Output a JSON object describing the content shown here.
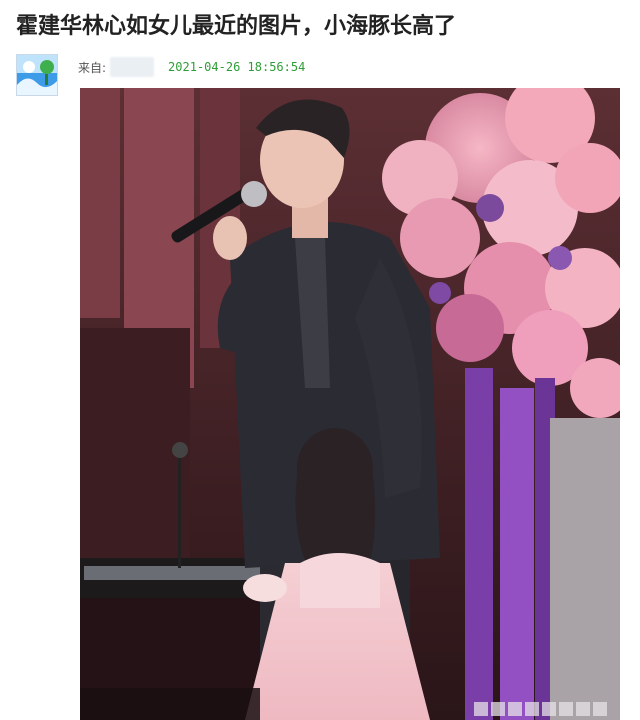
{
  "post": {
    "title": "霍建华林心如女儿最近的图片，小海豚长高了",
    "source_label": "来自:",
    "timestamp": "2021-04-26 18:56:54"
  },
  "avatar_icon": "user-avatar-landscape-icon",
  "colors": {
    "title": "#222222",
    "timestamp": "#2f9d37",
    "meta_label": "#555555"
  }
}
